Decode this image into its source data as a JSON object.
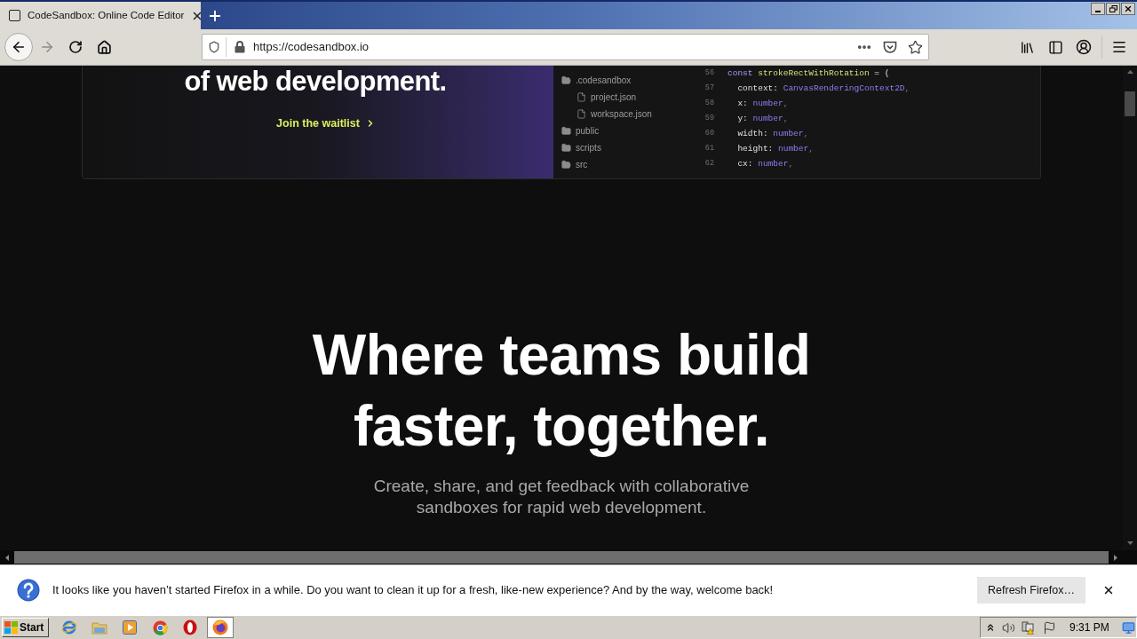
{
  "browser": {
    "tabs": [
      {
        "title": "CodeSandbox: Online Code Editor",
        "selected": true
      }
    ],
    "url": "https://codesandbox.io"
  },
  "card": {
    "heading": "of web development.",
    "link": "Join the waitlist",
    "file_tree": [
      {
        "name": ".codesandbox",
        "kind": "folder",
        "expanded": true,
        "children": [
          {
            "name": "project.json",
            "kind": "file"
          },
          {
            "name": "workspace.json",
            "kind": "file"
          }
        ]
      },
      {
        "name": "public",
        "kind": "folder",
        "expanded": false
      },
      {
        "name": "scripts",
        "kind": "folder",
        "expanded": false
      },
      {
        "name": "src",
        "kind": "folder",
        "expanded": true
      }
    ],
    "code_lines": [
      {
        "number": "56",
        "tokens": [
          {
            "kind": "keyword",
            "text": "const "
          },
          {
            "kind": "function",
            "text": "strokeRectWithRotation"
          },
          {
            "kind": "text",
            "text": " = ("
          }
        ]
      },
      {
        "number": "57",
        "tokens": [
          {
            "kind": "text",
            "text": "  context: "
          },
          {
            "kind": "type",
            "text": "CanvasRenderingContext2D"
          },
          {
            "kind": "punct",
            "text": ","
          }
        ]
      },
      {
        "number": "58",
        "tokens": [
          {
            "kind": "text",
            "text": "  x: "
          },
          {
            "kind": "type",
            "text": "number"
          },
          {
            "kind": "punct",
            "text": ","
          }
        ]
      },
      {
        "number": "59",
        "tokens": [
          {
            "kind": "text",
            "text": "  y: "
          },
          {
            "kind": "type",
            "text": "number"
          },
          {
            "kind": "punct",
            "text": ","
          }
        ]
      },
      {
        "number": "60",
        "tokens": [
          {
            "kind": "text",
            "text": "  width: "
          },
          {
            "kind": "type",
            "text": "number"
          },
          {
            "kind": "punct",
            "text": ","
          }
        ]
      },
      {
        "number": "61",
        "tokens": [
          {
            "kind": "text",
            "text": "  height: "
          },
          {
            "kind": "type",
            "text": "number"
          },
          {
            "kind": "punct",
            "text": ","
          }
        ]
      },
      {
        "number": "62",
        "tokens": [
          {
            "kind": "text",
            "text": "  cx: "
          },
          {
            "kind": "type",
            "text": "number"
          },
          {
            "kind": "punct",
            "text": ","
          }
        ]
      }
    ]
  },
  "hero": {
    "title": "Where teams build faster, together.",
    "subtitle": "Create, share, and get feedback with collaborative sandboxes for rapid web development."
  },
  "notification": {
    "message": "It looks like you haven’t started Firefox in a while. Do you want to clean it up for a fresh, like-new experience? And by the way, welcome back!",
    "button": "Refresh Firefox…"
  },
  "taskbar": {
    "start": "Start",
    "apps": [
      {
        "kind": "ie",
        "selected": false
      },
      {
        "kind": "explorer",
        "selected": false
      },
      {
        "kind": "media",
        "selected": false
      },
      {
        "kind": "chrome",
        "selected": false
      },
      {
        "kind": "opera",
        "selected": false
      },
      {
        "kind": "firefox",
        "selected": true
      }
    ],
    "clock": "9:31 PM"
  }
}
